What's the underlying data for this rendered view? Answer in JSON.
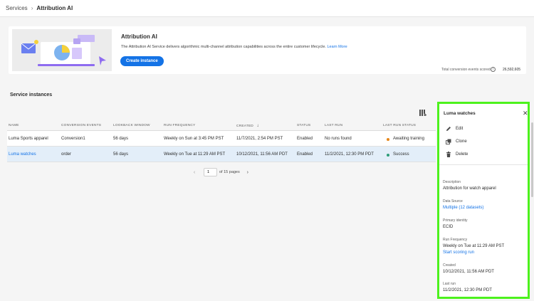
{
  "breadcrumb": {
    "parent": "Services",
    "current": "Attribution AI"
  },
  "service_card": {
    "title": "Attribution AI",
    "description": "The Attribution AI Service delivers algorithmic multi-channel attribution capabilities across the entire customer lifecycle.",
    "learn_more": "Learn More",
    "create_button": "Create instance",
    "conversion_label": "Total conversion events scored",
    "conversion_value": "26,592,605"
  },
  "section_title": "Service instances",
  "table": {
    "columns": {
      "name": "NAME",
      "conversion_events": "CONVERSION EVENTS",
      "lookback_window": "LOOKBACK WINDOW",
      "run_frequency": "RUN FREQUENCY",
      "created": "CREATED",
      "status": "STATUS",
      "last_run": "LAST RUN",
      "last_run_status": "LAST RUN STATUS"
    },
    "rows": [
      {
        "name": "Luma Sports apparel",
        "conversion_events": "Conversion1",
        "lookback_window": "56 days",
        "run_frequency": "Weekly on Sun at 3:45 PM PST",
        "created": "11/7/2021, 2:54 PM PST",
        "status": "Enabled",
        "last_run": "No runs found",
        "last_run_status": "Awaiting training",
        "status_color": "#e68619"
      },
      {
        "name": "Luma watches",
        "conversion_events": "order",
        "lookback_window": "56 days",
        "run_frequency": "Weekly on Tue at 11:29 AM PST",
        "created": "10/12/2021, 11:56 AM PDT",
        "status": "Enabled",
        "last_run": "11/2/2021, 12:30 PM PDT",
        "last_run_status": "Success",
        "status_color": "#2d9d78"
      }
    ]
  },
  "pagination": {
    "current": "1",
    "of_text": "of 15 pages"
  },
  "panel": {
    "title": "Luma watches",
    "actions": {
      "edit": "Edit",
      "clone": "Clone",
      "delete": "Delete"
    },
    "description_label": "Description",
    "description_value": "Attribution for watch apparel",
    "data_source_label": "Data Source",
    "data_source_value": "Multiple (12 datasets)",
    "primary_identity_label": "Primary identity",
    "primary_identity_value": "ECID",
    "run_frequency_label": "Run Frequency",
    "run_frequency_value": "Weekly on Tue at 11:29 AM PST",
    "start_scoring": "Start scoring run",
    "created_label": "Created",
    "created_value": "10/12/2021, 11:56 AM PDT",
    "last_run_label": "Last run",
    "last_run_value": "11/2/2021, 12:30 PM PDT"
  },
  "colors": {
    "accent": "#1473e6",
    "highlight_border": "#4df21d",
    "selected_row": "#e3eef9"
  },
  "icons": [
    "chevron-right-icon",
    "info-icon",
    "column-settings-icon",
    "sort-down-icon",
    "close-icon",
    "edit-icon",
    "clone-icon",
    "delete-icon",
    "chevron-left-icon"
  ]
}
